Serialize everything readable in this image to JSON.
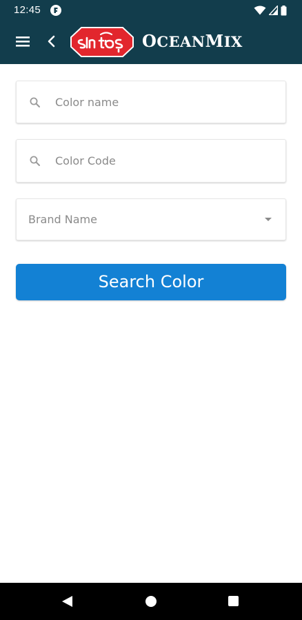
{
  "status_bar": {
    "time": "12:45"
  },
  "app_bar": {
    "logo_text": "SLN TOS",
    "title_first": "O",
    "title_rest": "CEAN",
    "title_m": "M",
    "title_end": "IX",
    "background_color": "#123d4c",
    "logo_color": "#e2262d"
  },
  "form": {
    "color_name_placeholder": "Color name",
    "color_code_placeholder": "Color Code",
    "brand_selected": "Brand Name",
    "search_button_label": "Search Color",
    "button_color": "#1381d4"
  },
  "icons": {
    "menu": "hamburger-menu",
    "back": "chevron-left",
    "search": "magnifier",
    "dropdown": "triangle-down",
    "nav_back": "triangle-left",
    "nav_home": "circle",
    "nav_recents": "square"
  }
}
